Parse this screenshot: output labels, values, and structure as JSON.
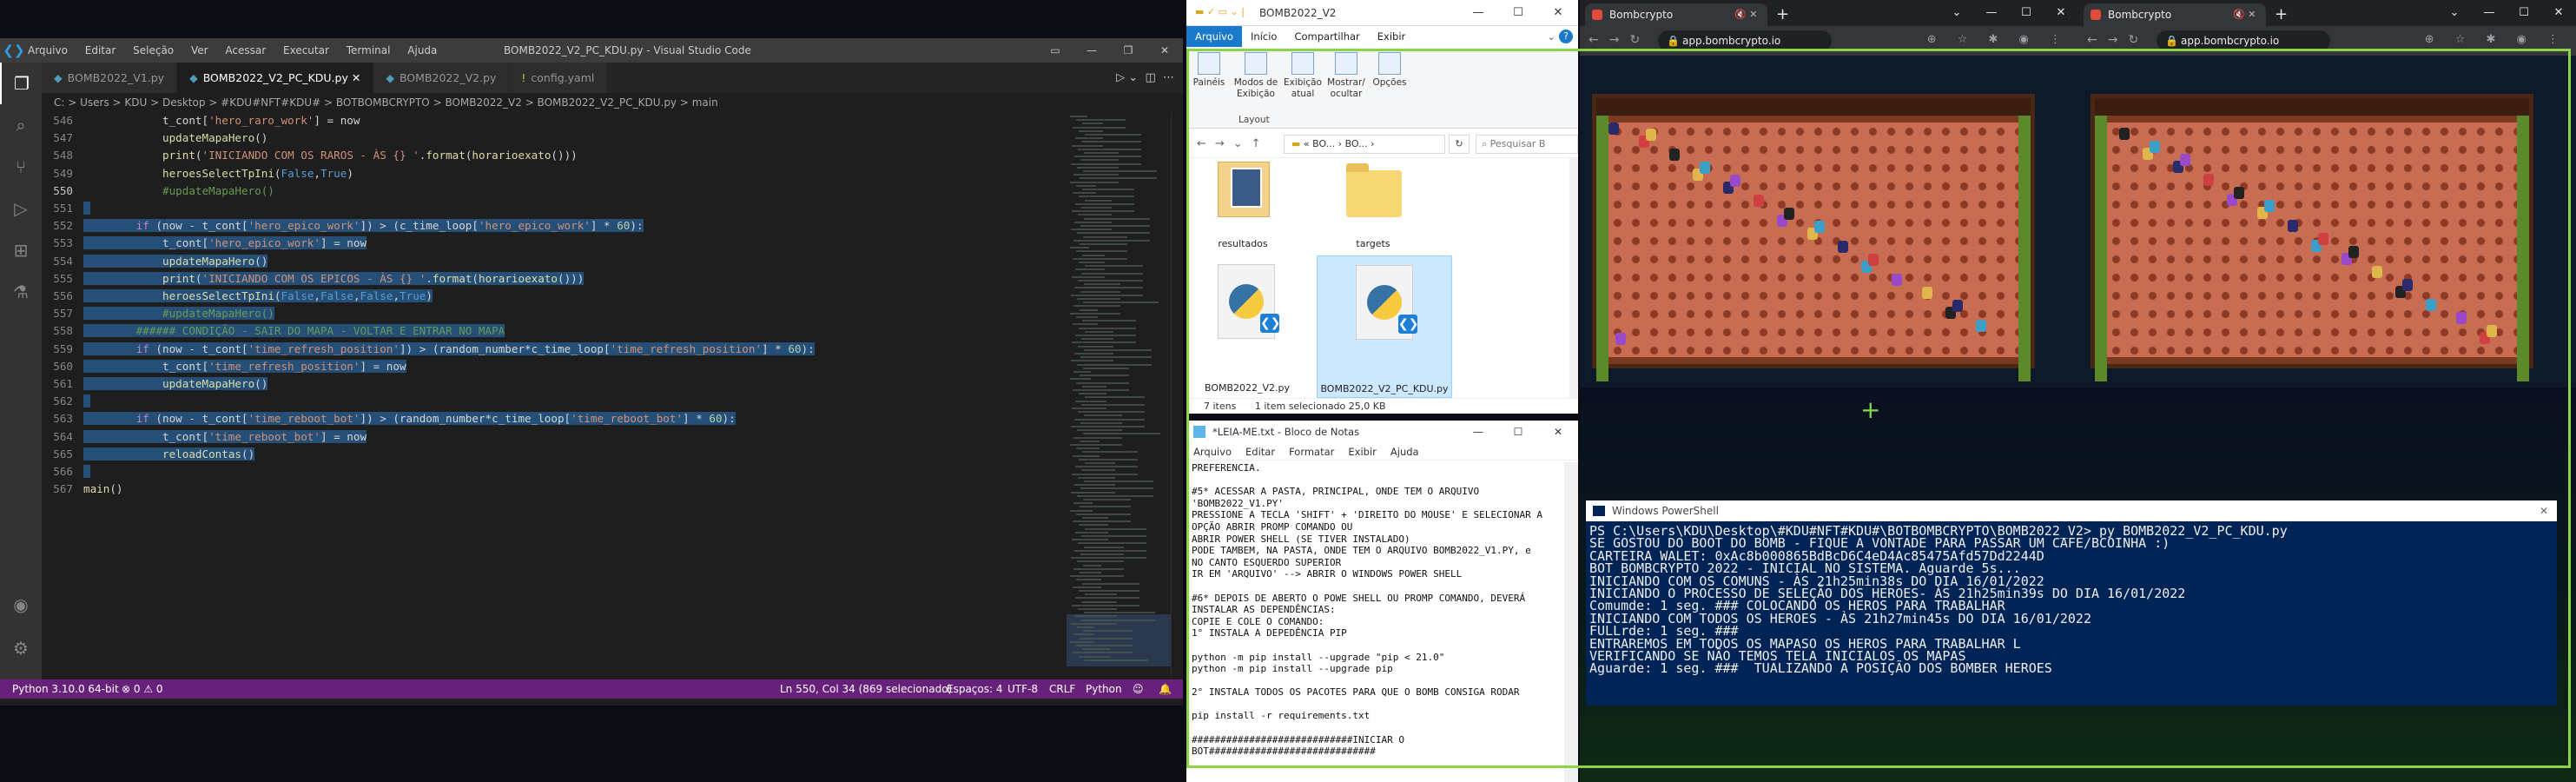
{
  "vscode": {
    "menu": [
      "Arquivo",
      "Editar",
      "Seleção",
      "Ver",
      "Acessar",
      "Executar",
      "Terminal",
      "Ajuda"
    ],
    "window_title": "BOMB2022_V2_PC_KDU.py - Visual Studio Code",
    "tabs": [
      {
        "label": "BOMB2022_V1.py"
      },
      {
        "label": "BOMB2022_V2_PC_KDU.py"
      },
      {
        "label": "BOMB2022_V2.py"
      },
      {
        "label": "config.yaml"
      }
    ],
    "breadcrumb": "C: > Users > KDU > Desktop > #KDU#NFT#KDU# > BOTBOMBCRYPTO > BOMB2022_V2 > BOMB2022_V2_PC_KDU.py > main",
    "lines": [
      {
        "n": "546",
        "t": "            t_cont['hero_raro_work'] = now"
      },
      {
        "n": "547",
        "t": "            updateMapaHero()"
      },
      {
        "n": "548",
        "t": "            print('INICIANDO COM OS RAROS - ÀS {} '.format(horarioexato()))"
      },
      {
        "n": "549",
        "t": "            heroesSelectTpIni(False,True)"
      },
      {
        "n": "550",
        "t": "            #updateMapaHero()"
      },
      {
        "n": "551",
        "t": ""
      },
      {
        "n": "552",
        "t": "        if (now - t_cont['hero_epico_work']) > (c_time_loop['hero_epico_work'] * 60):"
      },
      {
        "n": "553",
        "t": "            t_cont['hero_epico_work'] = now"
      },
      {
        "n": "554",
        "t": "            updateMapaHero()"
      },
      {
        "n": "555",
        "t": "            print('INICIANDO COM OS EPICOS - ÀS {} '.format(horarioexato()))"
      },
      {
        "n": "556",
        "t": "            heroesSelectTpIni(False,False,False,True)"
      },
      {
        "n": "557",
        "t": "            #updateMapaHero()"
      },
      {
        "n": "558",
        "t": "        ###### CONDIÇÃO - SAIR DO MAPA - VOLTAR E ENTRAR NO MAPA"
      },
      {
        "n": "559",
        "t": "        if (now - t_cont['time_refresh_position']) > (random_number*c_time_loop['time_refresh_position'] * 60):"
      },
      {
        "n": "560",
        "t": "            t_cont['time_refresh_position'] = now"
      },
      {
        "n": "561",
        "t": "            updateMapaHero()"
      },
      {
        "n": "562",
        "t": ""
      },
      {
        "n": "563",
        "t": "        if (now - t_cont['time_reboot_bot']) > (random_number*c_time_loop['time_reboot_bot'] * 60):"
      },
      {
        "n": "564",
        "t": "            t_cont['time_reboot_bot'] = now"
      },
      {
        "n": "565",
        "t": "            reloadContas()"
      },
      {
        "n": "566",
        "t": ""
      },
      {
        "n": "567",
        "t": "main()"
      }
    ],
    "status": {
      "python": "Python 3.10.0 64-bit",
      "problems": "⊗ 0 ⚠ 0",
      "position": "Ln 550, Col 34 (869 selecionado)",
      "spaces": "Espaços: 4",
      "encoding": "UTF-8",
      "eol": "CRLF",
      "language": "Python"
    }
  },
  "explorer": {
    "title": "BOMB2022_V2",
    "tabs": [
      "Arquivo",
      "Início",
      "Compartilhar",
      "Exibir"
    ],
    "ribbon": [
      "Painéis",
      "Modos de Exibição",
      "Exibição atual",
      "Mostrar/ ocultar",
      "Opções"
    ],
    "ribbon_group": "Layout",
    "path": "« BO... › BO... ›",
    "search": "Pesquisar B",
    "files": [
      {
        "name": "resultados"
      },
      {
        "name": "targets"
      },
      {
        "name": "BOMB2022_V2.py"
      },
      {
        "name": "BOMB2022_V2_PC_KDU.py"
      }
    ],
    "status_items": "7 itens",
    "status_sel": "1 item selecionado  25,0 KB"
  },
  "notepad": {
    "title": "*LEIA-ME.txt - Bloco de Notas",
    "menu": [
      "Arquivo",
      "Editar",
      "Formatar",
      "Exibir",
      "Ajuda"
    ],
    "text": "PREFERENCIA.\n\n#5* ACESSAR A PASTA, PRINCIPAL, ONDE TEM O ARQUIVO\n'BOMB2022_V1.PY'\nPRESSIONE A TECLA 'SHIFT' + 'DIREITO DO MOUSE' E SELECIONAR A\nOPÇÃO ABRIR PROMP COMANDO OU\nABRIR POWER SHELL (SE TIVER INSTALADO)\nPODE TAMBEM, NA PASTA, ONDE TEM O ARQUIVO BOMB2022_V1.PY, e\nNO CANTO ESQUERDO SUPERIOR\nIR EM 'ARQUIVO' --> ABRIR O WINDOWS POWER SHELL\n\n#6* DEPOIS DE ABERTO O POWE SHELL OU PROMP COMANDO, DEVERÁ\nINSTALAR AS DEPENDÊNCIAS:\nCOPIE E COLE O COMANDO:\n1° INSTALA A DEPEDÊNCIA PIP\n\npython -m pip install --upgrade \"pip < 21.0\"\npython -m pip install --upgrade pip\n\n2° INSTALA TODOS OS PACOTES PARA QUE O BOMB CONSIGA RODAR\n\npip install -r requirements.txt\n\n############################INICIAR O\nBOT#############################"
  },
  "browsers": [
    {
      "tab": "Bombcrypto",
      "url": "app.bombcrypto.io"
    },
    {
      "tab": "Bombcrypto",
      "url": "app.bombcrypto.io"
    }
  ],
  "powershell": {
    "title": "Windows PowerShell",
    "lines": [
      "PS C:\\Users\\KDU\\Desktop\\#KDU#NFT#KDU#\\BOTBOMBCRYPTO\\BOMB2022_V2> py BOMB2022_V2_PC_KDU.py",
      "SE GOSTOU DO BOOT DO BOMB - FIQUE A VONTADE PARA PASSAR UM CAFE/BCOINHA :)",
      "CARTEIRA WALET: 0xAc8b000865BdBcD6C4eD4Ac85475Afd57Dd2244D",
      "BOT BOMBCRYPTO 2022 - INICIAL NO SISTEMA. Aguarde 5s...",
      "INICIANDO COM OS COMUNS - ÀS 21h25min38s DO DIA 16/01/2022",
      "INICIANDO O PROCESSO DE SELEÇÃO DOS HEROES- ÀS 21h25min39s DO DIA 16/01/2022",
      "Comumde: 1 seg. ### COLOCANDO OS HEROS PARA TRABALHAR",
      "INICIANDO COM TODOS OS HEROES - ÀS 21h27min45s DO DIA 16/01/2022",
      "FULLrde: 1 seg. ###",
      "ENTRAREMOS EM TODOS OS MAPASO OS HEROS PARA TRABALHAR L",
      "VERIFICANDO SE NÃO TEMOS TELA INICIALOS OS MAPAS",
      "Aguarde: 1 seg. ###  TUALIZANDO A POSIÇÃO DOS BOMBER HEROES"
    ]
  }
}
